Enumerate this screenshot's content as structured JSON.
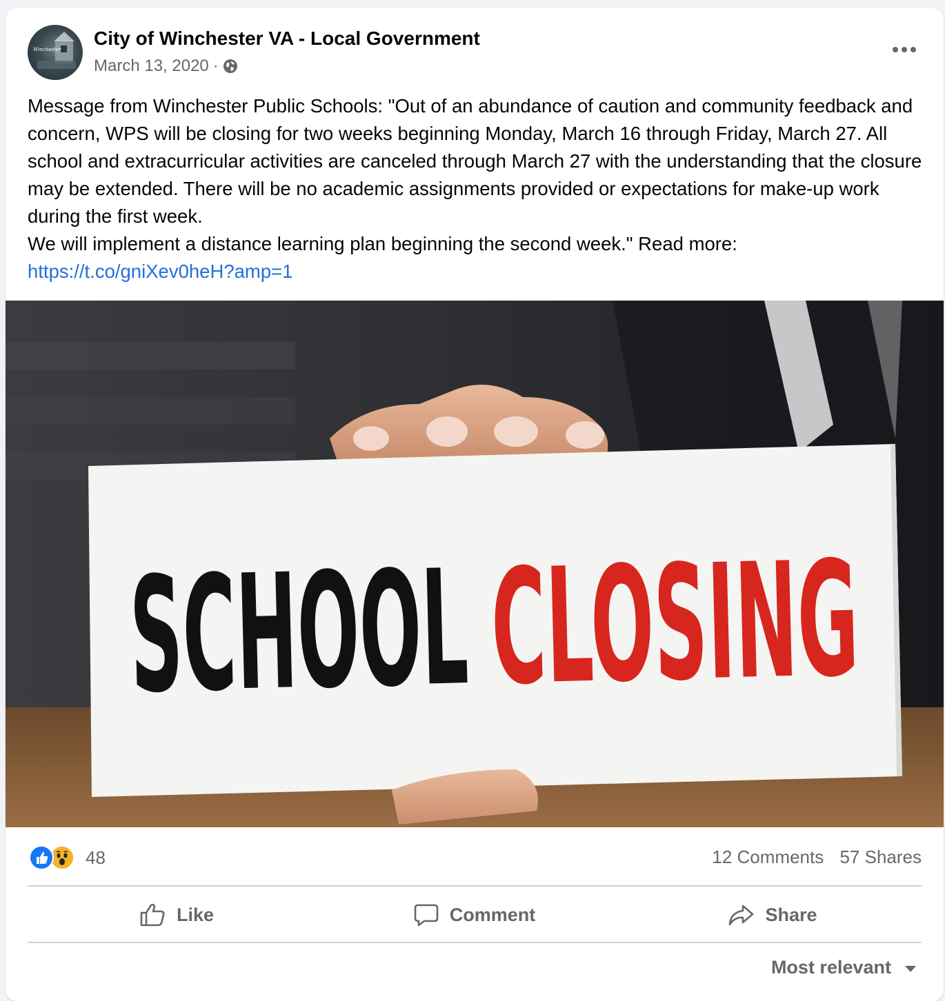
{
  "post": {
    "author": "City of Winchester VA - Local Government",
    "date": "March 13, 2020",
    "separator": "·",
    "privacy_icon": "globe-icon",
    "avatar_text": "Winchester",
    "text_paragraph_1": "Message from Winchester Public Schools: \"Out of an abundance of caution and community feedback and concern, WPS will be closing for two weeks beginning Monday, March 16 through Friday, March 27. All school and extracurricular activities are canceled through March 27 with the understanding that the closure may be extended. There will be no academic assignments provided or expectations for make-up work during the first week.",
    "text_paragraph_2": "We will implement a distance learning plan beginning the second week.\" Read more:",
    "link": "https://t.co/gniXev0heH?amp=1"
  },
  "image": {
    "word_1": "SCHOOL",
    "word_2": "CLOSING",
    "word_1_color": "#111111",
    "word_2_color": "#d7261e"
  },
  "stats": {
    "reactions": [
      "like-reaction-icon",
      "wow-reaction-icon"
    ],
    "reaction_count": "48",
    "comments": "12 Comments",
    "shares": "57 Shares"
  },
  "actions": {
    "like": "Like",
    "comment": "Comment",
    "share": "Share"
  },
  "sort": {
    "label": "Most relevant"
  },
  "colors": {
    "link": "#216fdb",
    "secondary_text": "#65676b",
    "like_blue": "#1877f2",
    "wow_yellow": "#f7b125"
  }
}
